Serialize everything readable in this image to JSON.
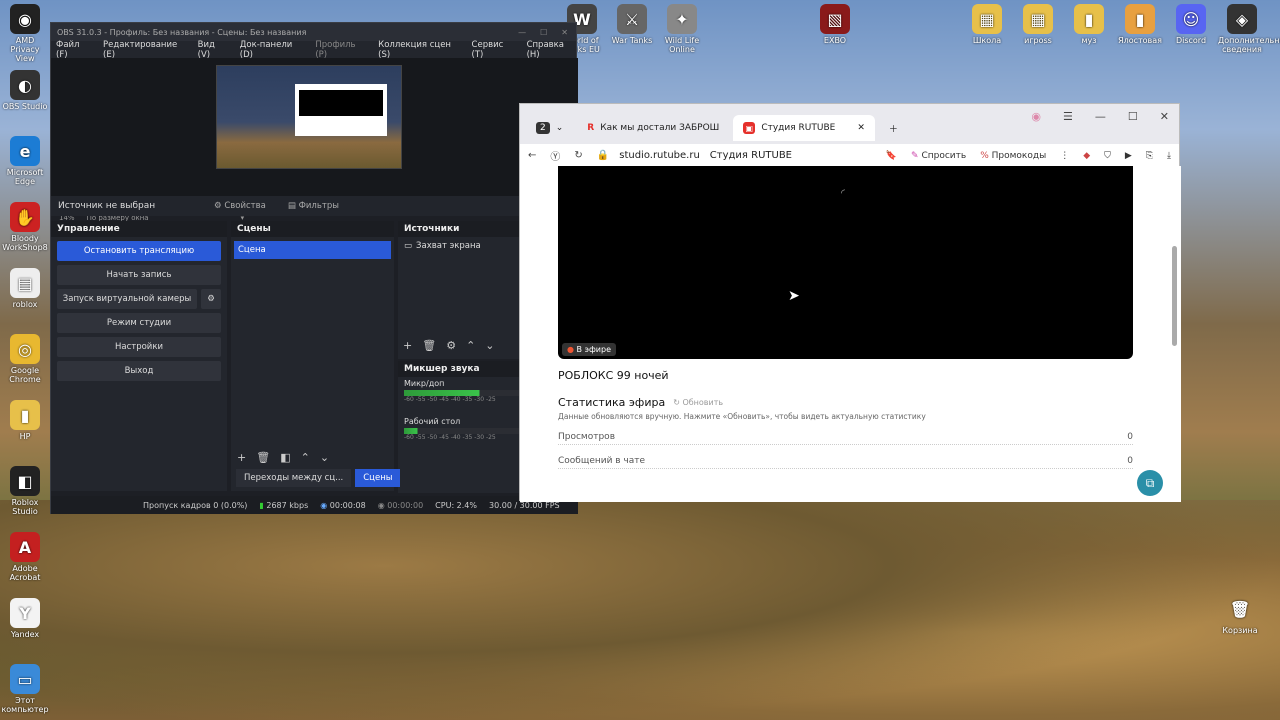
{
  "desktop": {
    "left_icons": [
      {
        "label": "AMD Privacy View",
        "glyph": "◉",
        "color": "#222"
      },
      {
        "label": "OBS Studio",
        "glyph": "◐",
        "color": "#333"
      },
      {
        "label": "Microsoft Edge",
        "glyph": "e",
        "color": "#1c7cd4"
      },
      {
        "label": "Bloody WorkShop8",
        "glyph": "✋",
        "color": "#c22"
      },
      {
        "label": "roblox",
        "glyph": "▤",
        "color": "#eee"
      },
      {
        "label": "Google Chrome",
        "glyph": "◎",
        "color": "#e8b830"
      },
      {
        "label": "HP",
        "glyph": "▮",
        "color": "#e7c04a"
      },
      {
        "label": "Roblox Studio",
        "glyph": "◧",
        "color": "#222"
      },
      {
        "label": "Adobe Acrobat",
        "glyph": "A",
        "color": "#c42020"
      },
      {
        "label": "Yandex",
        "glyph": "Y",
        "color": "#f3f3f3"
      },
      {
        "label": "Этот компьютер",
        "glyph": "▭",
        "color": "#3a8ad8"
      }
    ],
    "top_icons": [
      {
        "label": "World of Tanks EU",
        "glyph": "W",
        "color": "#444"
      },
      {
        "label": "War Tanks",
        "glyph": "⚔",
        "color": "#666"
      },
      {
        "label": "Wild Life Online",
        "glyph": "✦",
        "color": "#888"
      },
      {
        "label": "EXBO",
        "glyph": "▧",
        "color": "#8a1a1a"
      }
    ],
    "right_icons": [
      {
        "label": "Школа",
        "glyph": "▦",
        "color": "#e7c04a"
      },
      {
        "label": "игроss",
        "glyph": "▦",
        "color": "#e7c04a"
      },
      {
        "label": "муз",
        "glyph": "▮",
        "color": "#e7c04a"
      },
      {
        "label": "Ялостовая",
        "glyph": "▮",
        "color": "#e8a040"
      },
      {
        "label": "Discord",
        "glyph": "☺",
        "color": "#5865f2"
      },
      {
        "label": "Дополнительные сведения",
        "glyph": "◈",
        "color": "#333"
      },
      {
        "label": "Корзина",
        "glyph": "🗑",
        "color": "transparent"
      }
    ]
  },
  "obs": {
    "title": "OBS 31.0.3 - Профиль: Без названия - Сцены: Без названия",
    "menu": [
      "Файл (F)",
      "Редактирование (E)",
      "Вид (V)",
      "Док-панели (D)",
      "Профиль (P)",
      "Коллекция сцен (S)",
      "Сервис (T)",
      "Справка (H)"
    ],
    "zoom_pct": "14%",
    "zoom_mode": "По размеру окна",
    "no_source": "Источник не выбран",
    "properties": "Свойства",
    "filters": "Фильтры",
    "controls_title": "Управление",
    "controls": [
      "Остановить трансляцию",
      "Начать запись",
      "Запуск виртуальной камеры",
      "Режим студии",
      "Настройки",
      "Выход"
    ],
    "scenes_title": "Сцены",
    "scene_item": "Сцена",
    "sources_title": "Источники",
    "source_item": "Захват экрана",
    "mixer_title": "Микшер звука",
    "mixer_mic": "Микр/доп",
    "mixer_desktop": "Рабочий стол",
    "mixer_scale": "-60 -55 -50 -45 -40 -35 -30 -25",
    "transitions_tab": "Переходы между сц...",
    "scenes_tab": "Сцены",
    "status": {
      "dropped": "Пропуск кадров 0 (0.0%)",
      "bitrate": "2687 kbps",
      "live_time": "00:00:08",
      "rec_time": "00:00:00",
      "cpu": "CPU: 2.4%",
      "fps": "30.00 / 30.00 FPS"
    }
  },
  "browser": {
    "tab_count": "2",
    "tab1": "Как мы достали ЗАБРОШ",
    "tab2": "Студия RUTUBE",
    "url": "studio.rutube.ru",
    "page_title": "Студия RUTUBE",
    "ask": "Спросить",
    "promo": "Промокоды",
    "live_badge": "В эфире",
    "stream_title": "РОБЛОКС 99 ночей",
    "stats_title": "Статистика эфира",
    "refresh": "Обновить",
    "stats_note": "Данные обновляются вручную. Нажмите «Обновить», чтобы видеть актуальную статистику",
    "stats": [
      {
        "label": "Просмотров",
        "value": "0"
      },
      {
        "label": "Сообщений в чате",
        "value": "0"
      }
    ]
  }
}
